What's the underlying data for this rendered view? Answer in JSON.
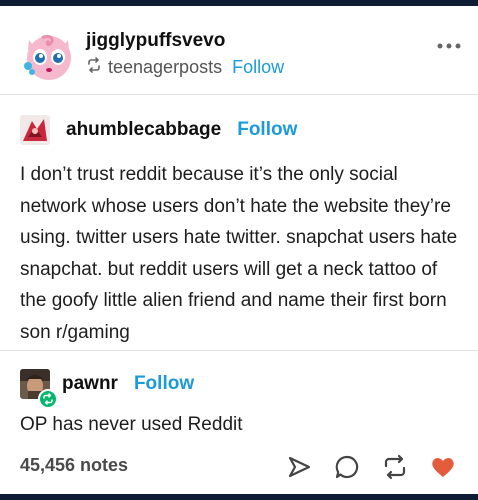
{
  "header": {
    "username": "jigglypuffsvevo",
    "reblogged_from": "teenagerposts",
    "follow_label": "Follow",
    "avatar_icon": "jigglypuff-avatar",
    "more_icon": "more-horizontal-icon"
  },
  "thread": [
    {
      "username": "ahumblecabbage",
      "follow_label": "Follow",
      "text": "I don’t trust reddit because it’s the only social network whose users don’t hate the website they’re using. twitter users hate twitter. snapchat users hate snapchat. but reddit users will get a neck tattoo of the goofy little alien friend and name their first born son r/gaming"
    },
    {
      "username": "pawnr",
      "follow_label": "Follow",
      "text": "OP has never used Reddit"
    }
  ],
  "footer": {
    "notes": "45,456 notes",
    "actions": [
      "share-icon",
      "reply-icon",
      "reblog-icon",
      "like-icon"
    ]
  },
  "colors": {
    "follow": "#1b9bd8",
    "like": "#e35c3c",
    "bar": "#0e1d33",
    "reblog_badge": "#00b86b"
  }
}
